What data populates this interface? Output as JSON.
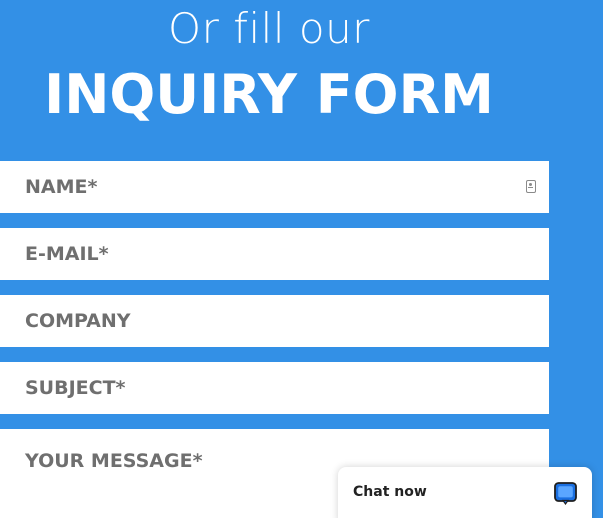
{
  "header": {
    "subtitle": "Or fill our",
    "title": "INQUIRY FORM"
  },
  "form": {
    "name_placeholder": "NAME*",
    "email_placeholder": "E-MAIL*",
    "company_placeholder": "COMPANY",
    "subject_placeholder": "SUBJECT*",
    "message_placeholder": "YOUR MESSAGE*"
  },
  "chat": {
    "label": "Chat now",
    "icon": "chat-bubble-icon"
  },
  "colors": {
    "background_blue": "#3390e6",
    "field_background": "#ffffff",
    "placeholder_text": "#6f6f6f",
    "chat_icon_border": "#1f1f1f",
    "chat_icon_accent": "#1a6fe0"
  }
}
